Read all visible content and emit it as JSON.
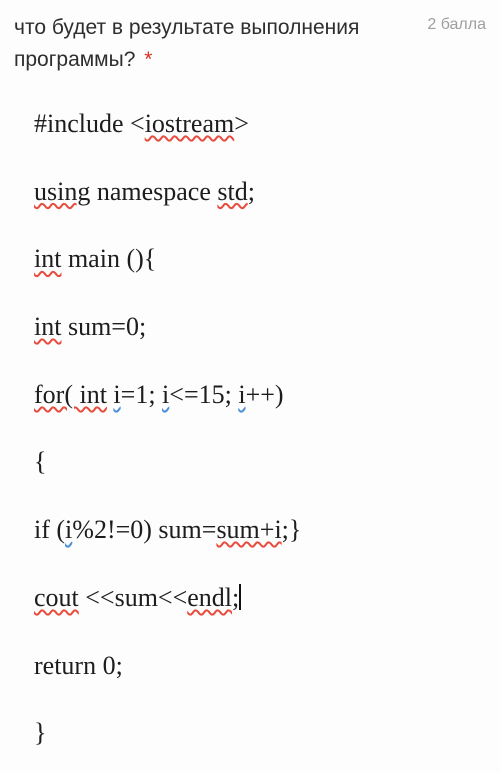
{
  "question": {
    "text": "что будет в результате выполнения программы?",
    "required_mark": "*",
    "points": "2 балла"
  },
  "code": {
    "line1": {
      "p1": "#include <",
      "p2": "iostream",
      "p3": ">"
    },
    "line2": {
      "p1": "using",
      "p2": " namespace ",
      "p3": "std",
      "p4": ";"
    },
    "line3": {
      "p1": "int",
      "p2": " main (){"
    },
    "line4": {
      "p1": " ",
      "p2": "int",
      "p3": " sum=0;"
    },
    "line5": {
      "p1": " ",
      "p2": "for( int",
      "p3": " ",
      "p4": "i",
      "p5": "=1; ",
      "p6": "i",
      "p7": "<=15; ",
      "p8": "i",
      "p9": "++)"
    },
    "line6": {
      "p1": "{"
    },
    "line7": {
      "p1": "if (",
      "p2": "i",
      "p3": "%2!=0) sum=",
      "p4": "sum+i",
      "p5": ";}"
    },
    "line8": {
      "p1": "cout",
      "p2": " <<sum<<",
      "p3": "endl",
      "p4": ";"
    },
    "line9": {
      "p1": "return 0;"
    },
    "line10": {
      "p1": "}"
    }
  }
}
